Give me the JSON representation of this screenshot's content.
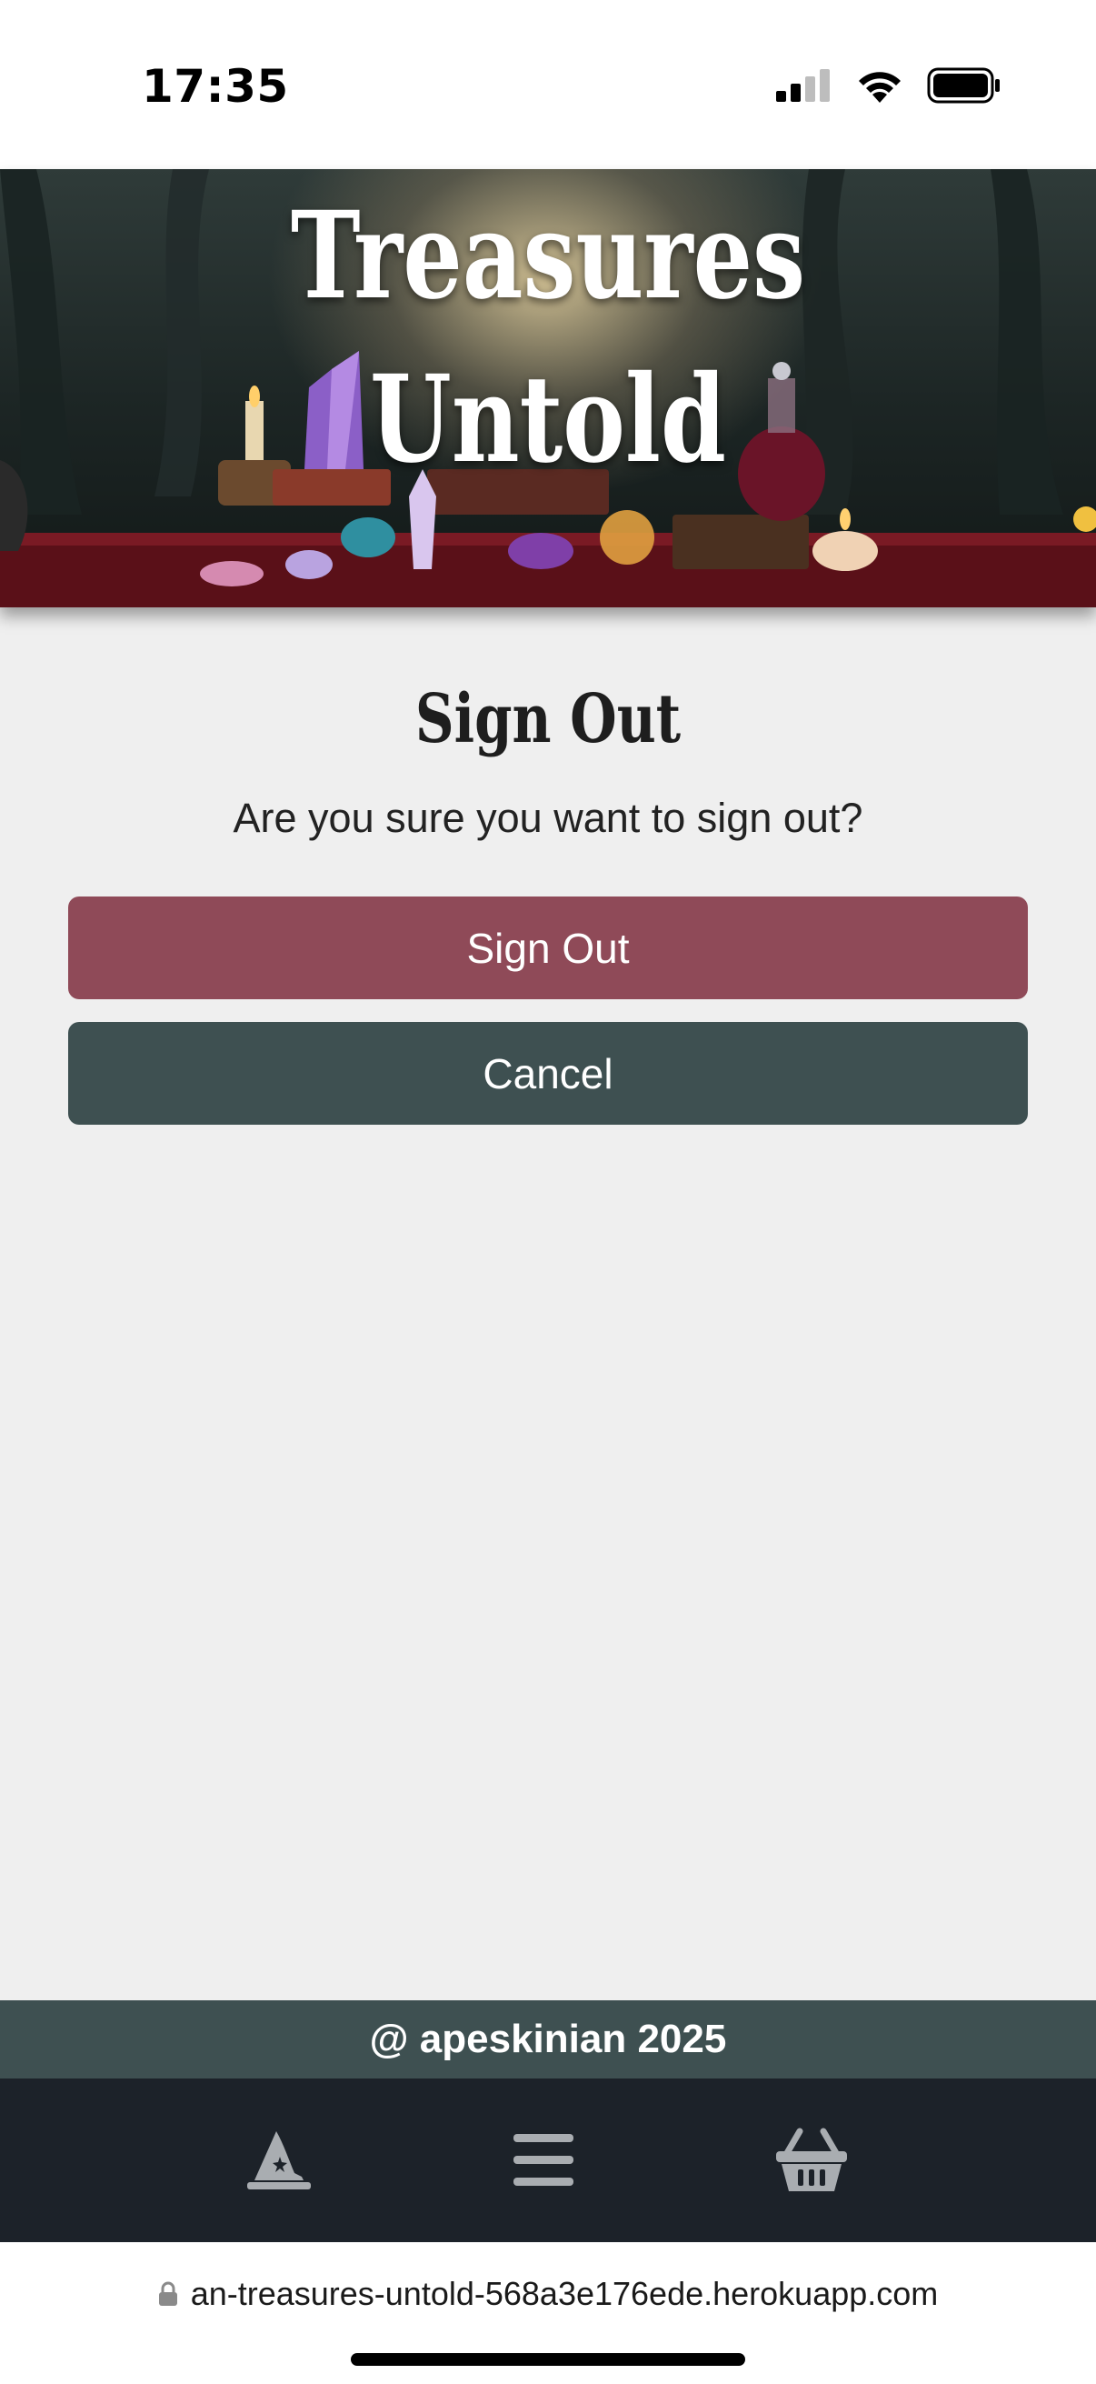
{
  "status_bar": {
    "time": "17:35",
    "icons": [
      "cellular-signal-icon",
      "wifi-icon",
      "battery-icon"
    ]
  },
  "hero": {
    "title_line1": "Treasures",
    "title_line2": "Untold"
  },
  "main": {
    "title": "Sign Out",
    "prompt": "Are you sure you want to sign out?",
    "signout_label": "Sign Out",
    "cancel_label": "Cancel"
  },
  "footer": {
    "text": "@ apeskinian 2025"
  },
  "bottom_nav": {
    "items": [
      "wizard-hat-icon",
      "menu-icon",
      "basket-icon"
    ]
  },
  "browser": {
    "url": "an-treasures-untold-568a3e176ede.herokuapp.com"
  },
  "colors": {
    "signout_button": "#8f4a58",
    "cancel_button": "#3e5051",
    "footer": "#3e5051",
    "bottom_nav": "#1c2229",
    "page_background": "#efefef"
  }
}
